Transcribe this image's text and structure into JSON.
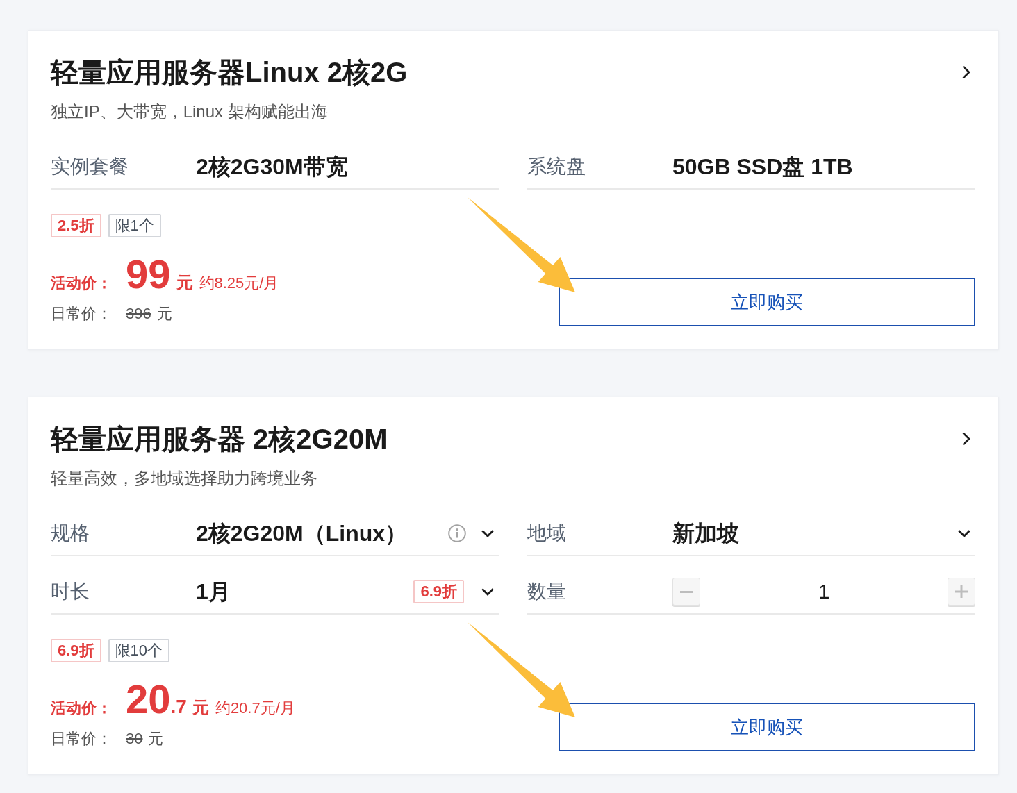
{
  "products": [
    {
      "title": "轻量应用服务器Linux 2核2G",
      "subtitle": "独立IP、大带宽，Linux 架构赋能出海",
      "fields": [
        {
          "kind": "static",
          "label": "实例套餐",
          "value": "2核2G30M带宽",
          "info": false
        },
        {
          "kind": "static",
          "label": "系统盘",
          "value": "50GB SSD盘 1TB",
          "info": false
        }
      ],
      "tags": [
        {
          "kind": "discount",
          "text": "2.5折"
        },
        {
          "kind": "limit",
          "text": "限1个"
        }
      ],
      "promo_price": {
        "label": "活动价：",
        "integer": "99",
        "unit": "元",
        "monthly": "约8.25元/月"
      },
      "regular_price": {
        "label": "日常价：",
        "amount": "396",
        "unit": "元"
      },
      "buy_button": "立即购买",
      "arrow": true
    },
    {
      "title": "轻量应用服务器 2核2G20M",
      "subtitle": "轻量高效，多地域选择助力跨境业务",
      "fields": [
        {
          "kind": "select",
          "label": "规格",
          "value": "2核2G20M（Linux）",
          "info": true
        },
        {
          "kind": "select",
          "label": "地域",
          "value": "新加坡",
          "info": false
        },
        {
          "kind": "select",
          "label": "时长",
          "value": "1月",
          "badge": "6.9折",
          "info": false
        },
        {
          "kind": "stepper",
          "label": "数量",
          "value": "1",
          "info": false
        }
      ],
      "tags": [
        {
          "kind": "discount",
          "text": "6.9折"
        },
        {
          "kind": "limit",
          "text": "限10个"
        }
      ],
      "promo_price": {
        "label": "活动价：",
        "integer": "20",
        "decimal": ".7",
        "unit": "元",
        "monthly": "约20.7元/月"
      },
      "regular_price": {
        "label": "日常价：",
        "amount": "30",
        "unit": "元"
      },
      "buy_button": "立即购买",
      "arrow": true
    }
  ]
}
